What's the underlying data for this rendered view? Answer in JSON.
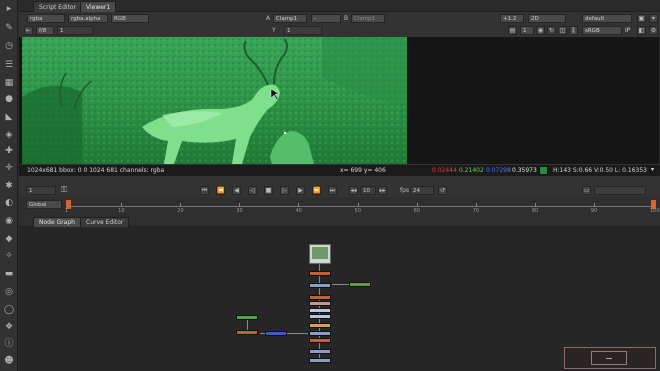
{
  "tabs": {
    "script_editor": "Script Editor",
    "viewer": "Viewer1"
  },
  "viewer_controls": {
    "channels": "rgba",
    "alpha": "rgba.alpha",
    "display": "RGB",
    "a_label": "A",
    "a_input": "Clamp1",
    "wipe": "-",
    "b_label": "B",
    "b_input": "Clamp1",
    "gain": "+1.2",
    "view_mode": "2D",
    "lut": "default",
    "frame_fraction": "f/8",
    "downrez": "1",
    "y_label": "Y",
    "y_value": "1",
    "zoom": "1",
    "colorspace": "sRGB",
    "ip": "IP"
  },
  "info_bar": {
    "format": "1024x681 bbox: 0 0 1024 681 channels: rgba",
    "coords": "x= 699 y= 406",
    "red": "0.02444",
    "green": "0.21402",
    "blue": "0.07298",
    "alpha": "0.35973",
    "hsvl": "H:143 S:0.66 V:0.50  L: 0.16353"
  },
  "playback": {
    "current_frame": "1",
    "step": "10",
    "fps_label": "fps",
    "fps": "24"
  },
  "timeline": {
    "scope": "Global",
    "ticks": [
      "1",
      "10",
      "20",
      "30",
      "40",
      "50",
      "60",
      "70",
      "80",
      "90",
      "100"
    ],
    "end_frame": "100"
  },
  "panels": {
    "node_graph": "Node Graph",
    "curve_editor": "Curve Editor"
  },
  "colors": {
    "image_tint": "#2f9e4a",
    "red_value": "#e04040",
    "green_value": "#60d060",
    "blue_value": "#5070ff",
    "swatch": "#2c8a48"
  },
  "icons": [
    "pointer-icon",
    "brush-icon",
    "clock-icon",
    "channel-icon",
    "color-icon",
    "sphere-icon",
    "filter-icon",
    "layers-icon",
    "merge-icon",
    "transform-icon",
    "3d-icon",
    "particle-icon",
    "deep-icon",
    "views-icon",
    "metadata-icon",
    "toolsets-icon",
    "other-icon",
    "render-icon",
    "gizmo-icon",
    "help-icon"
  ]
}
